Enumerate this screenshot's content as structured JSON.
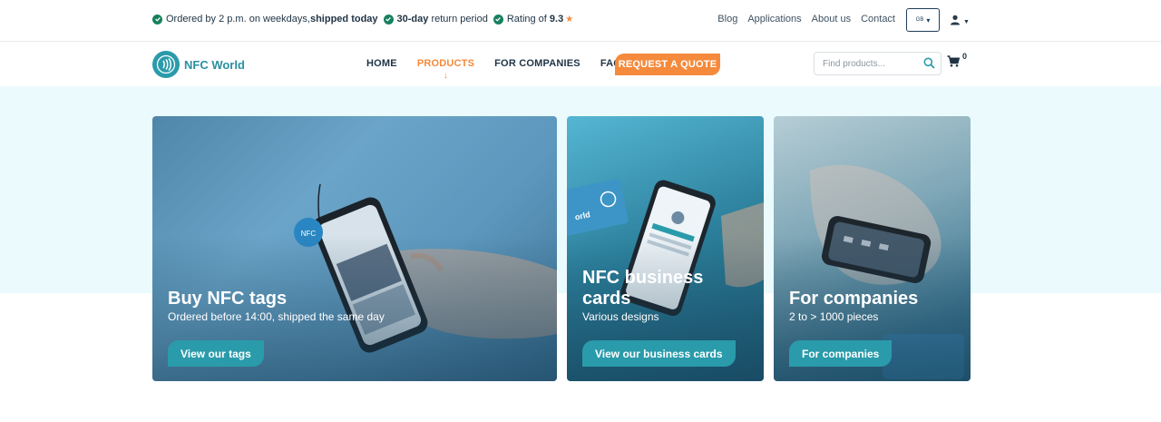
{
  "topbar": {
    "usps": [
      {
        "pre": "Ordered by 2 p.m. on weekdays, ",
        "bold": "shipped today",
        "post": ""
      },
      {
        "pre": "",
        "bold": "30-day",
        "post": " return period"
      },
      {
        "pre": "Rating of ",
        "bold": "9.3",
        "post": ""
      }
    ],
    "links": [
      "Blog",
      "Applications",
      "About us",
      "Contact"
    ],
    "language": "GB"
  },
  "nav": {
    "logo_text": "NFC World",
    "menu": [
      {
        "label": "HOME",
        "active": false
      },
      {
        "label": "PRODUCTS",
        "active": true
      },
      {
        "label": "FOR COMPANIES",
        "active": false
      },
      {
        "label": "FAQ",
        "active": false
      }
    ],
    "quote_label": "REQUEST A QUOTE",
    "search_placeholder": "Find products...",
    "cart_count": "0"
  },
  "cards": [
    {
      "title": "Buy NFC tags",
      "subtitle": "Ordered before 14:00, shipped the same day",
      "cta": "View our tags"
    },
    {
      "title": "NFC business cards",
      "subtitle": "Various designs",
      "cta": "View our business cards"
    },
    {
      "title": "For companies",
      "subtitle": "2 to > 1000 pieces",
      "cta": "For companies"
    }
  ],
  "colors": {
    "accent": "#f58a3c",
    "brand": "#2a9bab",
    "check": "#17805e",
    "hero_bg": "#ebfafc"
  },
  "icons": [
    "check-circle-icon",
    "star-icon",
    "user-icon",
    "search-icon",
    "cart-icon",
    "nfc-logo-icon",
    "arrow-down-icon"
  ]
}
